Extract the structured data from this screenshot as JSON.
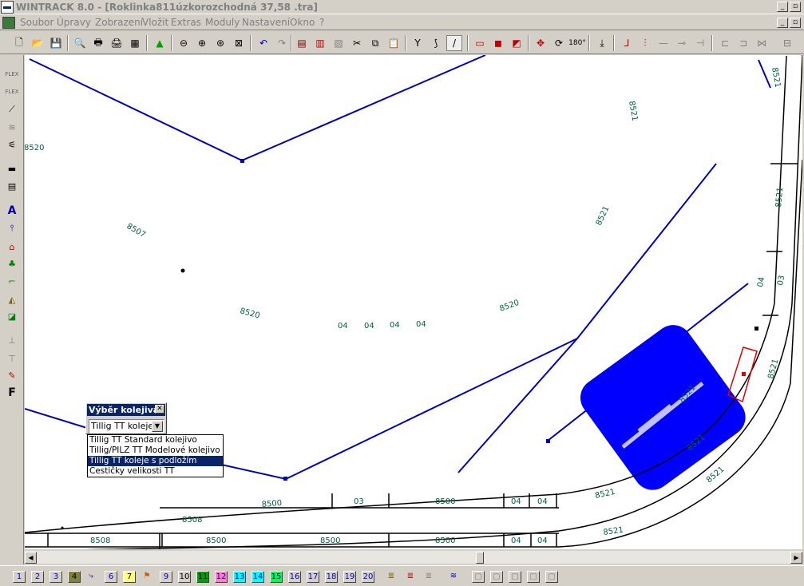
{
  "window": {
    "title": "WINTRACK 8.0 - [Roklinka811úzkorozchodná 37,58 .tra]",
    "minimize": "_",
    "restore": "▫",
    "close": "✕"
  },
  "menu": [
    "Soubor",
    "Úpravy",
    "Zobrazení",
    "Vložit",
    "Extras",
    "Moduly",
    "Nastavení",
    "Okno",
    "?"
  ],
  "dialog": {
    "title": "Výběr kolejiva",
    "close": "✕",
    "selected": "Tillig TT koleje s podložím",
    "options": [
      "Tillig TT Standard kolejivo",
      "Tillig/PILZ TT Modelové kolejivo",
      "Tillig TT koleje s podložím",
      "Cestičky velikosti TT"
    ],
    "selected_index": 2
  },
  "canvas_labels": {
    "l1": "8520",
    "l2": "8507",
    "l3": "8520",
    "l4": "8520",
    "l5": "8521",
    "l6": "8521",
    "l7": "8521",
    "l8": "8521",
    "l9": "8521",
    "l10": "8521",
    "l11": "8521",
    "l12": "8500",
    "l13": "8500",
    "l14": "8500",
    "l15": "8500",
    "l16": "8500",
    "l17": "8521",
    "l18": "8521",
    "l19": "8508",
    "l20": "8508",
    "l21": "04",
    "l22": "04",
    "l23": "04",
    "l24": "04",
    "l25": "03",
    "l26": "04",
    "l27": "04",
    "l28": "04",
    "l29": "04",
    "l30": "04",
    "l31": "03",
    "l32": "8521"
  },
  "layers": [
    "1",
    "2",
    "3",
    "4",
    "6",
    "7",
    "9",
    "10",
    "11",
    "12",
    "13",
    "14",
    "15",
    "16",
    "17",
    "18",
    "19",
    "20"
  ],
  "layer_colors": {
    "4": "#808040",
    "7": "#ffff80",
    "11": "#00a000",
    "12": "#ff80c0",
    "14": "#00ffff",
    "15": "#00ff40"
  },
  "icons": {
    "toolbar": [
      "new-file-icon",
      "open-folder-icon",
      "save-icon",
      "print-preview-icon",
      "print-icon",
      "print-setup-icon",
      "calculator-icon",
      "landscape-icon",
      "zoom-out-icon",
      "zoom-in-icon",
      "zoom-window-icon",
      "zoom-fit-icon",
      "undo-icon",
      "redo-icon",
      "parts-list-icon",
      "copy-parts-icon",
      "clipboard-icon",
      "cut-icon",
      "copy-icon",
      "paste-icon",
      "split-track-icon",
      "curve-icon",
      "line-tool-icon",
      "layer-icon",
      "color-red-icon",
      "color-swap-icon",
      "move-icon",
      "rotate-icon",
      "rotate-180-icon",
      "insert-icon",
      "join-icon",
      "snap-icon",
      "flex-icon",
      "connect-icon",
      "branch-icon",
      "grid-icon",
      "grid-off-icon",
      "options-icon"
    ],
    "sidebar": [
      "flex-track-icon",
      "flex-track-2-icon",
      "slope-icon",
      "bridge-icon",
      "signal-icon",
      "platform-icon",
      "building-icon",
      "text-icon",
      "height-marker-icon",
      "house-icon",
      "tree-icon",
      "stairs-icon",
      "terrain-icon",
      "landscape-icon",
      "measure-icon",
      "ruler-icon",
      "brush-icon",
      "font-icon"
    ]
  }
}
